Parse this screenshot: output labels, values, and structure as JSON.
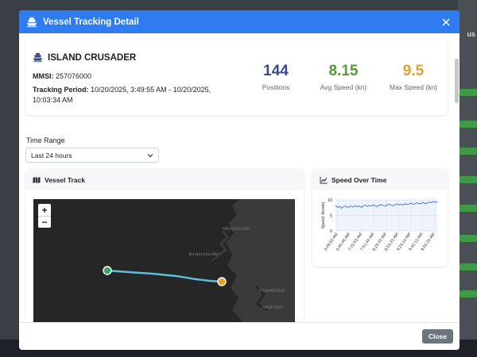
{
  "modal": {
    "title": "Vessel Tracking Detail",
    "close_label": "Close"
  },
  "vessel": {
    "name": "ISLAND CRUSADER",
    "mmsi_label": "MMSI:",
    "mmsi": "257076000",
    "period_label": "Tracking Period:",
    "period": "10/20/2025, 3:49:55 AM - 10/20/2025, 10:03:34 AM"
  },
  "stats": [
    {
      "value": "144",
      "label": "Positions",
      "color": "#3a4a8c"
    },
    {
      "value": "8.15",
      "label": "Avg Speed (kn)",
      "color": "#5a9a3e"
    },
    {
      "value": "9.5",
      "label": "Max Speed (kn)",
      "color": "#e0a13a"
    }
  ],
  "time_range": {
    "label": "Time Range",
    "selected": "Last 24 hours"
  },
  "track": {
    "title": "Vessel Track",
    "zoom_in": "+",
    "zoom_out": "−",
    "place_labels": [
      "HAUGESUND",
      "Bergensfjorden",
      "STAVANGER",
      "SANDNES"
    ],
    "start_color": "#3aa56b",
    "end_color": "#e6a11f",
    "line_color": "#5bc0de"
  },
  "speed": {
    "title": "Speed Over Time"
  },
  "background": {
    "header_fragment": "us",
    "tag_colors": [
      "#3f9a48",
      "#3f9a48",
      "#3f9a48",
      "#3f9a48",
      "#3f9a48",
      "#3f9a48",
      "#3f9a48",
      "#3f9a48"
    ]
  },
  "chart_data": {
    "type": "line",
    "title": "",
    "xlabel": "",
    "ylabel": "Speed (knots)",
    "ylim": [
      0,
      10
    ],
    "yticks": [
      0,
      5,
      10
    ],
    "x": [
      "3:49:55 AM",
      "6:45:46 AM",
      "7:20:53 AM",
      "7:51:44 AM",
      "8:25:43 AM",
      "8:53:23 AM",
      "9:23:14 AM",
      "9:42:13 AM",
      "9:55:33 AM"
    ],
    "series": [
      {
        "values": [
          8.2,
          7.6,
          7.9,
          7.3,
          7.8,
          8.1,
          7.5,
          7.9,
          8.0,
          7.7,
          8.2,
          7.8,
          8.0,
          7.6,
          8.1,
          8.3,
          7.9,
          8.2,
          8.0,
          8.4,
          8.1,
          7.9,
          8.3,
          8.5,
          8.2,
          8.0,
          8.4,
          8.6,
          8.3,
          8.1,
          8.5,
          8.7,
          8.4,
          8.6,
          8.3,
          8.8,
          8.5,
          8.7,
          9.0,
          8.6,
          8.8,
          9.1,
          8.7,
          8.9,
          9.2,
          8.8,
          9.0,
          9.3,
          9.1,
          9.5,
          9.2,
          9.4
        ],
        "color": "#3a6fd8"
      }
    ],
    "grid": true,
    "legend": "none"
  }
}
